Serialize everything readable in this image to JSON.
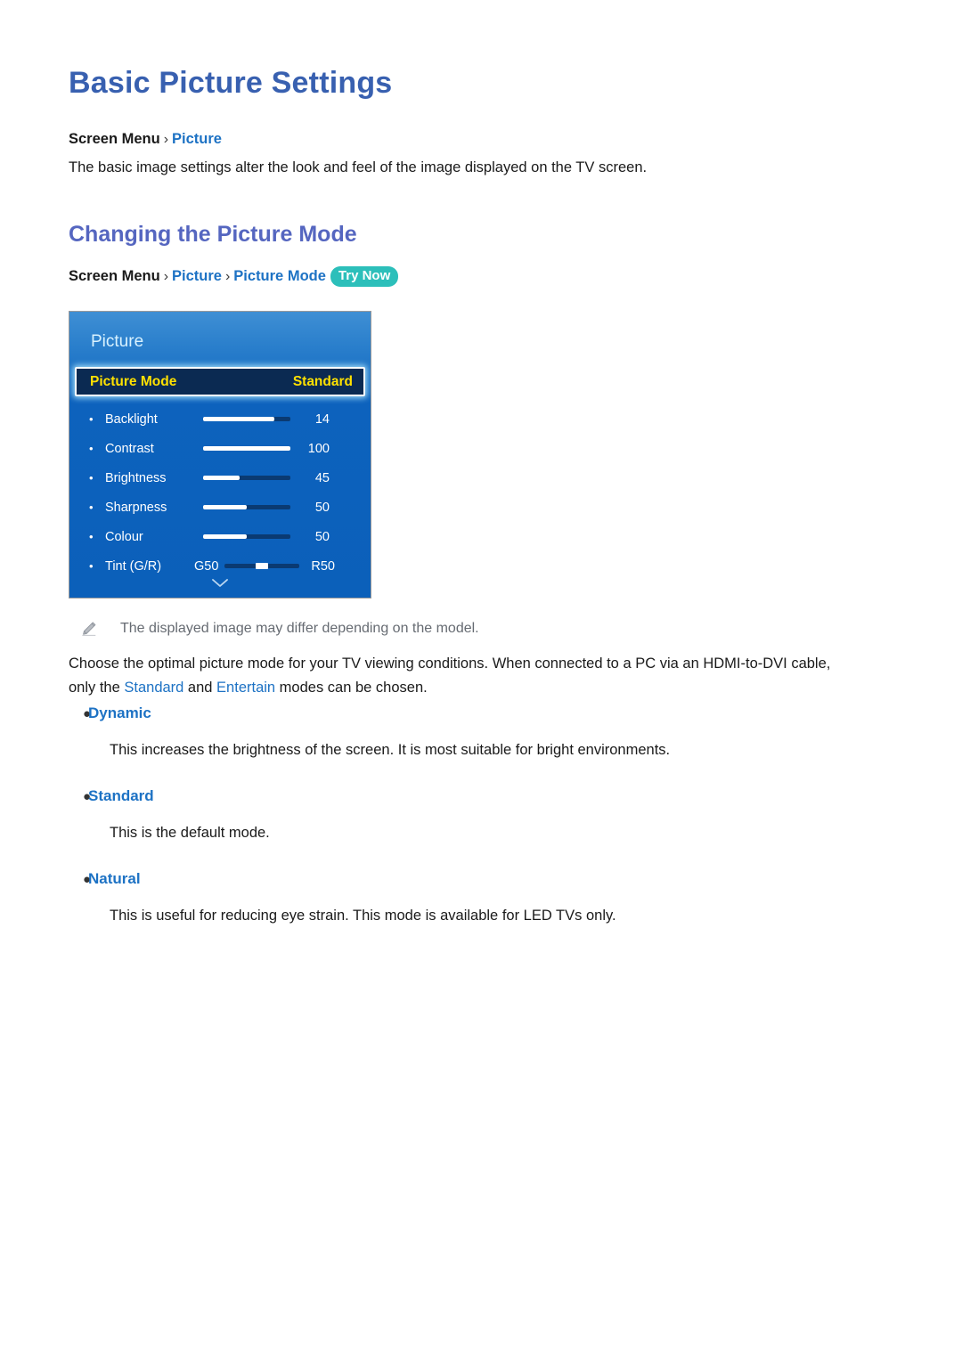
{
  "document": {
    "title": "Basic Picture Settings",
    "intro_paragraph": "The basic image settings alter the look and feel of the image displayed on the TV screen.",
    "section_title": "Changing the Picture Mode"
  },
  "breadcrumb_top": {
    "root": "Screen Menu",
    "separator": "›",
    "leaf": "Picture"
  },
  "breadcrumb_section": {
    "root": "Screen Menu",
    "separator": "›",
    "level2": "Picture",
    "level3": "Picture Mode",
    "badge": "Try Now"
  },
  "tv_menu": {
    "title": "Picture",
    "highlight": {
      "label": "Picture Mode",
      "value": "Standard"
    },
    "rows": [
      {
        "label": "Backlight",
        "value": "14",
        "fill_percent": 82,
        "type": "slider"
      },
      {
        "label": "Contrast",
        "value": "100",
        "fill_percent": 100,
        "type": "slider"
      },
      {
        "label": "Brightness",
        "value": "45",
        "fill_percent": 42,
        "type": "slider"
      },
      {
        "label": "Sharpness",
        "value": "50",
        "fill_percent": 50,
        "type": "slider"
      },
      {
        "label": "Colour",
        "value": "50",
        "fill_percent": 50,
        "type": "slider"
      },
      {
        "label": "Tint (G/R)",
        "value": "R50",
        "start_label": "G50",
        "fill_percent": 50,
        "type": "centered"
      }
    ],
    "scroll_hint_icon": "chevron-down-icon"
  },
  "note": {
    "icon": "pencil-icon",
    "text": "The displayed image may differ depending on the model."
  },
  "choose_paragraph": {
    "part1": "Choose the optimal picture mode for your TV viewing conditions. When connected to a PC via an HDMI-to-DVI cable, only the ",
    "highlight1": "Standard",
    "part2": " and ",
    "highlight2": "Entertain",
    "part3": " modes can be chosen."
  },
  "mode_list": [
    {
      "title": "Dynamic",
      "description": "This increases the brightness of the screen. It is most suitable for bright environments."
    },
    {
      "title": "Standard",
      "description": "This is the default mode."
    },
    {
      "title": "Natural",
      "description": "This is useful for reducing eye strain. This mode is available for LED TVs only."
    }
  ],
  "colors": {
    "heading_blue": "#3860b0",
    "subheading_blue": "#5566c0",
    "link_blue": "#1d72c4",
    "badge_teal": "#2cbfba",
    "menu_blue": "#0b60ba",
    "highlight_navy": "#0b2a52",
    "highlight_yellow": "#ffe100",
    "note_gray": "#666b72"
  }
}
